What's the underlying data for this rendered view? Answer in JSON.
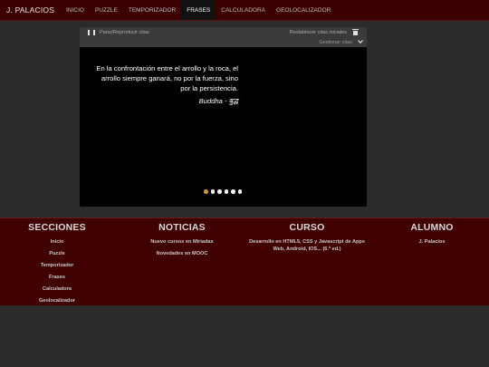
{
  "nav": {
    "brand": "J. PALACIOS",
    "links": [
      "INICIO",
      "PUZZLE",
      "TEMPORIZADOR",
      "FRASES",
      "CALCULADORA",
      "GEOLOCALIZADOR"
    ],
    "active": "FRASES"
  },
  "player": {
    "pause_label": "Parar/Reproducir citas",
    "reset_label": "Restablecer citas iniciales",
    "manage_label": "Gestionar citas",
    "quote": "En la confrontación entre el arrollo y la roca, el arrollo siempre ganará, no por la fuerza, sino por la persistencia.",
    "author": "Buddha - बुद्ध",
    "slide_count": 6,
    "active_slide": 1,
    "active_dot_color": "#d98c3a"
  },
  "footer": {
    "secciones": {
      "title": "SECCIONES",
      "items": [
        "Inicio",
        "Puzzle",
        "Temporizador",
        "Frases",
        "Calculadora",
        "Geolocalizador"
      ]
    },
    "noticias": {
      "title": "NOTICIAS",
      "items": [
        "Nuevo cursos en Miriadax",
        "Novedades en MOOC"
      ]
    },
    "curso": {
      "title": "CURSO",
      "items": [
        "Desarrollo en HTML5, CSS y Javascript de Apps Web, Android, IOS... (6.ª ed.)"
      ]
    },
    "alumno": {
      "title": "ALUMNO",
      "items": [
        "J. Palacios"
      ]
    }
  },
  "colors": {
    "navbar": "#3d0000",
    "footer": "#400000",
    "background": "#2b2b2b"
  }
}
